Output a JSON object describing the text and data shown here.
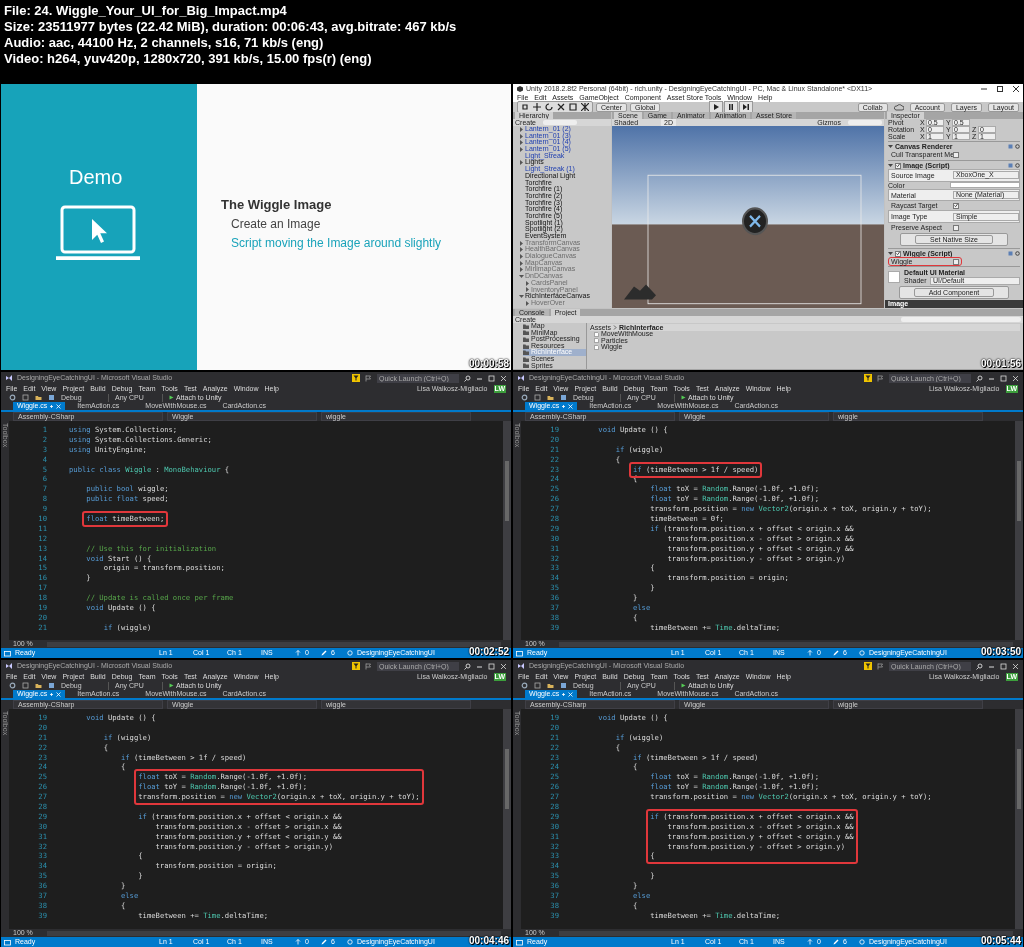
{
  "header": [
    "File: 24. Wiggle_Your_UI_for_Big_Impact.mp4",
    "Size: 23511977 bytes (22.42 MiB), duration: 00:06:43, avg.bitrate: 467 kb/s",
    "Audio: aac, 44100 Hz, 2 channels, s16, 71 kb/s (eng)",
    "Video: h264, yuv420p, 1280x720, 391 kb/s, 15.00 fps(r) (eng)"
  ],
  "frames": [
    {
      "kind": "slide",
      "side_title": "Demo",
      "heading": "The Wiggle Image",
      "points": [
        {
          "text": "Create an Image",
          "accent": false
        },
        {
          "text": "Script moving the Image around slightly",
          "accent": true
        }
      ],
      "timestamp": "00:00:58"
    },
    {
      "kind": "unity",
      "title": "Unity 2018.2.8f2 Personal (64bit) - rich.unity - DesigningEyeCatchingUI - PC, Mac & Linux Standalone* <DX11>",
      "menu": [
        "File",
        "Edit",
        "Assets",
        "GameObject",
        "Component",
        "Asset Store Tools",
        "Window",
        "Help"
      ],
      "pivot_buttons": [
        "Center",
        "Global"
      ],
      "right_buttons": [
        "Collab",
        "Account",
        "Layers",
        "Layout"
      ],
      "hierarchy": {
        "tab": "Hierarchy",
        "create": "Create",
        "items": [
          {
            "label": "Lantern_01 (2)",
            "kind": "collapsed",
            "prefab": true,
            "inactive": false
          },
          {
            "label": "Lantern_01 (3)",
            "kind": "collapsed",
            "prefab": true,
            "inactive": false
          },
          {
            "label": "Lantern_01 (4)",
            "kind": "collapsed",
            "prefab": true,
            "inactive": false
          },
          {
            "label": "Lantern_01 (5)",
            "kind": "collapsed",
            "prefab": true,
            "inactive": false
          },
          {
            "label": "Light_Streak",
            "kind": "leaf",
            "prefab": true,
            "inactive": false
          },
          {
            "label": "Lights",
            "kind": "collapsed",
            "prefab": false,
            "inactive": false
          },
          {
            "label": "Light_Streak (1)",
            "kind": "leaf",
            "prefab": true,
            "inactive": false
          },
          {
            "label": "Directional Light",
            "kind": "leaf",
            "prefab": false,
            "inactive": false
          },
          {
            "label": "Torchfire",
            "kind": "leaf",
            "prefab": false,
            "inactive": false
          },
          {
            "label": "Torchfire (1)",
            "kind": "leaf",
            "prefab": false,
            "inactive": false
          },
          {
            "label": "Torchfire (2)",
            "kind": "leaf",
            "prefab": false,
            "inactive": false
          },
          {
            "label": "Torchfire (3)",
            "kind": "leaf",
            "prefab": false,
            "inactive": false
          },
          {
            "label": "Torchfire (4)",
            "kind": "leaf",
            "prefab": false,
            "inactive": false
          },
          {
            "label": "Torchfire (5)",
            "kind": "leaf",
            "prefab": false,
            "inactive": false
          },
          {
            "label": "Spotlight (1)",
            "kind": "leaf",
            "prefab": false,
            "inactive": false
          },
          {
            "label": "Spotlight (2)",
            "kind": "leaf",
            "prefab": false,
            "inactive": false
          },
          {
            "label": "EventSystem",
            "kind": "leaf",
            "prefab": false,
            "inactive": false
          },
          {
            "label": "TransformCanvas",
            "kind": "collapsed",
            "prefab": false,
            "inactive": true
          },
          {
            "label": "HealthBarCanvas",
            "kind": "collapsed",
            "prefab": false,
            "inactive": true
          },
          {
            "label": "DialogueCanvas",
            "kind": "collapsed",
            "prefab": false,
            "inactive": true
          },
          {
            "label": "MapCanvas",
            "kind": "collapsed",
            "prefab": false,
            "inactive": true
          },
          {
            "label": "MinimapCanvas",
            "kind": "collapsed",
            "prefab": false,
            "inactive": true
          },
          {
            "label": "DnDCanvas",
            "kind": "expanded",
            "prefab": false,
            "inactive": true,
            "children": [
              {
                "label": "CardsPanel",
                "kind": "collapsed",
                "prefab": false,
                "inactive": true
              },
              {
                "label": "InventoryPanel",
                "kind": "collapsed",
                "prefab": false,
                "inactive": true
              }
            ]
          },
          {
            "label": "RichInterfaceCanvas",
            "kind": "expanded",
            "prefab": false,
            "inactive": false,
            "children": [
              {
                "label": "HoverOver",
                "kind": "collapsed",
                "prefab": false,
                "inactive": true
              }
            ]
          }
        ]
      },
      "scene": {
        "tabs": [
          {
            "label": "Scene",
            "selected": true
          },
          {
            "label": "Game",
            "selected": false
          },
          {
            "label": "Animator",
            "selected": false
          },
          {
            "label": "Animation",
            "selected": false
          },
          {
            "label": "Asset Store",
            "selected": false
          }
        ],
        "shading": "Shaded",
        "mode": "2D",
        "gizmos": "Gizmos"
      },
      "inspector": {
        "tab": "Inspector",
        "rows": [
          {
            "kind": "vector",
            "label": "Pivot",
            "values": [
              {
                "axis": "X",
                "value": "0.5"
              },
              {
                "axis": "Y",
                "value": "0.5"
              }
            ]
          },
          {
            "kind": "vector",
            "label": "Rotation",
            "values": [
              {
                "axis": "X",
                "value": "0"
              },
              {
                "axis": "Y",
                "value": "0"
              },
              {
                "axis": "Z",
                "value": "0"
              }
            ]
          },
          {
            "kind": "vector",
            "label": "Scale",
            "values": [
              {
                "axis": "X",
                "value": "1"
              },
              {
                "axis": "Y",
                "value": "1"
              },
              {
                "axis": "Z",
                "value": "1"
              }
            ]
          },
          {
            "kind": "component",
            "title": "Canvas Renderer"
          },
          {
            "kind": "checkbox",
            "label": "Cull Transparent Me",
            "checked": false,
            "highlighted": false
          },
          {
            "kind": "script",
            "title": "Image (Script)",
            "enabled": true
          },
          {
            "kind": "field",
            "label": "Source Image",
            "value": "XboxOne_X"
          },
          {
            "kind": "color",
            "label": "Color"
          },
          {
            "kind": "field",
            "label": "Material",
            "value": "None (Material)"
          },
          {
            "kind": "checkbox",
            "label": "Raycast Target",
            "checked": true,
            "highlighted": false
          },
          {
            "kind": "field",
            "label": "Image Type",
            "value": "Simple"
          },
          {
            "kind": "checkbox",
            "label": "Preserve Aspect",
            "checked": false,
            "highlighted": false
          },
          {
            "kind": "button",
            "label": "Set Native Size"
          },
          {
            "kind": "script",
            "title": "Wiggle (Script)",
            "enabled": true
          },
          {
            "kind": "checkbox",
            "label": "Wiggle",
            "checked": false,
            "highlighted": true
          },
          {
            "kind": "material",
            "title": "Default UI Material",
            "shader_label": "Shader",
            "shader": "UI/Default"
          },
          {
            "kind": "button",
            "label": "Add Component"
          }
        ],
        "preview": "Image"
      },
      "project": {
        "tabs": [
          {
            "label": "Console",
            "selected": false
          },
          {
            "label": "Project",
            "selected": true
          }
        ],
        "create": "Create",
        "folders": [
          {
            "label": "Map",
            "selected": false
          },
          {
            "label": "MiniMap",
            "selected": false
          },
          {
            "label": "PostProcessing",
            "selected": false
          },
          {
            "label": "Resources",
            "selected": false
          },
          {
            "label": "RichInterface",
            "selected": true
          },
          {
            "label": "Scenes",
            "selected": false
          },
          {
            "label": "Sprites",
            "selected": false
          }
        ],
        "path": [
          "Assets",
          "RichInterface"
        ],
        "files": [
          "MoveWithMouse",
          "Particles",
          "Wiggle"
        ]
      },
      "timestamp": "00:01:56"
    },
    {
      "kind": "editor",
      "title": "DesigningEyeCatchingUI - Microsoft Visual Studio",
      "search": {
        "placeholder": "Quick Launch (Ctrl+Q)"
      },
      "menu": [
        "File",
        "Edit",
        "View",
        "Project",
        "Build",
        "Debug",
        "Team",
        "Tools",
        "Test",
        "Analyze",
        "Window",
        "Help"
      ],
      "user": "Lisa Walkosz-Migliacio",
      "user_initials": "LW",
      "toolbar": [
        "Debug",
        "Any CPU"
      ],
      "run_button": "Attach to Unity",
      "tabs": [
        {
          "label": "Wiggle.cs",
          "selected": true
        },
        {
          "label": "ItemAction.cs",
          "selected": false
        },
        {
          "label": "MoveWithMouse.cs",
          "selected": false
        },
        {
          "label": "CardAction.cs",
          "selected": false
        }
      ],
      "side_panel": "Toolbox",
      "nav": [
        "Assembly-CSharp",
        "Wiggle",
        "wiggle"
      ],
      "zoom": "100 %",
      "status": {
        "text": "Ready",
        "line": "Ln 1",
        "column": "Col 1",
        "char": "Ch 1",
        "mode": "INS",
        "up_count": "0",
        "edit_count": "6",
        "project": "DesigningEyeCatchingUI"
      },
      "timestamp": "00:02:52",
      "code": [
        {
          "number": "1",
          "highlighted": false,
          "tokens": [
            {
              "kind": "kw",
              "text": "using"
            },
            {
              "kind": "plain",
              "text": " System.Collections;"
            }
          ]
        },
        {
          "number": "2",
          "highlighted": false,
          "tokens": [
            {
              "kind": "kw",
              "text": "using"
            },
            {
              "kind": "plain",
              "text": " System.Collections.Generic;"
            }
          ]
        },
        {
          "number": "3",
          "highlighted": false,
          "tokens": [
            {
              "kind": "kw",
              "text": "using"
            },
            {
              "kind": "plain",
              "text": " UnityEngine;"
            }
          ]
        },
        {
          "number": "4",
          "highlighted": false
        },
        {
          "number": "5",
          "highlighted": false,
          "tokens": [
            {
              "kind": "kw",
              "text": "public class "
            },
            {
              "kind": "type",
              "text": "Wiggle"
            },
            {
              "kind": "plain",
              "text": " : "
            },
            {
              "kind": "type",
              "text": "MonoBehaviour"
            },
            {
              "kind": "plain",
              "text": " {"
            }
          ]
        },
        {
          "number": "6",
          "highlighted": false
        },
        {
          "number": "7",
          "highlighted": false,
          "tokens": [
            {
              "kind": "kw",
              "text": "    public bool"
            },
            {
              "kind": "plain",
              "text": " wiggle;"
            }
          ]
        },
        {
          "number": "8",
          "highlighted": false,
          "tokens": [
            {
              "kind": "kw",
              "text": "    public float"
            },
            {
              "kind": "plain",
              "text": " speed;"
            }
          ]
        },
        {
          "number": "9",
          "highlighted": false
        },
        {
          "number": "10",
          "highlighted": true,
          "tokens": [
            {
              "kind": "kw",
              "text": "    float"
            },
            {
              "kind": "plain",
              "text": " timeBetween;"
            }
          ]
        },
        {
          "number": "11",
          "highlighted": false
        },
        {
          "number": "12",
          "highlighted": false
        },
        {
          "number": "13",
          "highlighted": false,
          "tokens": [
            {
              "kind": "comment",
              "text": "    // Use this for initialization"
            }
          ]
        },
        {
          "number": "14",
          "highlighted": false,
          "tokens": [
            {
              "kind": "kw",
              "text": "    void"
            },
            {
              "kind": "plain",
              "text": " Start () {"
            }
          ]
        },
        {
          "number": "15",
          "highlighted": false,
          "tokens": [
            {
              "kind": "plain",
              "text": "        origin = transform.position;"
            }
          ]
        },
        {
          "number": "16",
          "highlighted": false,
          "tokens": [
            {
              "kind": "plain",
              "text": "    }"
            }
          ]
        },
        {
          "number": "17",
          "highlighted": false
        },
        {
          "number": "18",
          "highlighted": false,
          "tokens": [
            {
              "kind": "comment",
              "text": "    // Update is called once per frame"
            }
          ]
        },
        {
          "number": "19",
          "highlighted": false,
          "tokens": [
            {
              "kind": "kw",
              "text": "    void"
            },
            {
              "kind": "plain",
              "text": " Update () {"
            }
          ]
        },
        {
          "number": "20",
          "highlighted": false
        },
        {
          "number": "21",
          "highlighted": false,
          "tokens": [
            {
              "kind": "kw",
              "text": "        if"
            },
            {
              "kind": "plain",
              "text": " (wiggle)"
            }
          ]
        }
      ]
    },
    {
      "kind": "editor",
      "title": "DesigningEyeCatchingUI - Microsoft Visual Studio",
      "search": {
        "placeholder": "Quick Launch (Ctrl+Q)"
      },
      "menu": [
        "File",
        "Edit",
        "View",
        "Project",
        "Build",
        "Debug",
        "Team",
        "Tools",
        "Test",
        "Analyze",
        "Window",
        "Help"
      ],
      "user": "Lisa Walkosz-Migliacio",
      "user_initials": "LW",
      "toolbar": [
        "Debug",
        "Any CPU"
      ],
      "run_button": "Attach to Unity",
      "tabs": [
        {
          "label": "Wiggle.cs",
          "selected": true
        },
        {
          "label": "ItemAction.cs",
          "selected": false
        },
        {
          "label": "MoveWithMouse.cs",
          "selected": false
        },
        {
          "label": "CardAction.cs",
          "selected": false
        }
      ],
      "side_panel": "Toolbox",
      "nav": [
        "Assembly-CSharp",
        "Wiggle",
        "wiggle"
      ],
      "zoom": "100 %",
      "status": {
        "text": "Ready",
        "line": "Ln 1",
        "column": "Col 1",
        "char": "Ch 1",
        "mode": "INS",
        "up_count": "0",
        "edit_count": "6",
        "project": "DesigningEyeCatchingUI"
      },
      "timestamp": "00:03:50",
      "code": [
        {
          "number": "19",
          "highlighted": false,
          "tokens": [
            {
              "kind": "kw",
              "text": "    void"
            },
            {
              "kind": "plain",
              "text": " Update () {"
            }
          ]
        },
        {
          "number": "20",
          "highlighted": false
        },
        {
          "number": "21",
          "highlighted": false,
          "tokens": [
            {
              "kind": "kw",
              "text": "        if"
            },
            {
              "kind": "plain",
              "text": " (wiggle)"
            }
          ]
        },
        {
          "number": "22",
          "highlighted": false,
          "tokens": [
            {
              "kind": "plain",
              "text": "        {"
            }
          ]
        },
        {
          "number": "23",
          "highlighted": true,
          "tokens": [
            {
              "kind": "kw",
              "text": "            if"
            },
            {
              "kind": "plain",
              "text": " (timeBetween > 1f / speed)"
            }
          ]
        },
        {
          "number": "24",
          "highlighted": false,
          "tokens": [
            {
              "kind": "plain",
              "text": "            {"
            }
          ]
        },
        {
          "number": "25",
          "highlighted": false,
          "tokens": [
            {
              "kind": "kw",
              "text": "                float"
            },
            {
              "kind": "plain",
              "text": " toX = "
            },
            {
              "kind": "type",
              "text": "Random"
            },
            {
              "kind": "plain",
              "text": ".Range(-1.0f, +1.0f);"
            }
          ]
        },
        {
          "number": "26",
          "highlighted": false,
          "tokens": [
            {
              "kind": "kw",
              "text": "                float"
            },
            {
              "kind": "plain",
              "text": " toY = "
            },
            {
              "kind": "type",
              "text": "Random"
            },
            {
              "kind": "plain",
              "text": ".Range(-1.0f, +1.0f);"
            }
          ]
        },
        {
          "number": "27",
          "highlighted": false,
          "tokens": [
            {
              "kind": "plain",
              "text": "                transform.position = "
            },
            {
              "kind": "kw",
              "text": "new "
            },
            {
              "kind": "type",
              "text": "Vector2"
            },
            {
              "kind": "plain",
              "text": "(origin.x + toX, origin.y + toY);"
            }
          ]
        },
        {
          "number": "28",
          "highlighted": false,
          "tokens": [
            {
              "kind": "plain",
              "text": "                timeBetween = 0f;"
            }
          ]
        },
        {
          "number": "29",
          "highlighted": false,
          "tokens": [
            {
              "kind": "kw",
              "text": "                if"
            },
            {
              "kind": "plain",
              "text": " (transform.position.x + offset < origin.x &&"
            }
          ]
        },
        {
          "number": "30",
          "highlighted": false,
          "tokens": [
            {
              "kind": "plain",
              "text": "                    transform.position.x - offset > origin.x &&"
            }
          ]
        },
        {
          "number": "31",
          "highlighted": false,
          "tokens": [
            {
              "kind": "plain",
              "text": "                    transform.position.y + offset < origin.y &&"
            }
          ]
        },
        {
          "number": "32",
          "highlighted": false,
          "tokens": [
            {
              "kind": "plain",
              "text": "                    transform.position.y - offset > origin.y)"
            }
          ]
        },
        {
          "number": "33",
          "highlighted": false,
          "tokens": [
            {
              "kind": "plain",
              "text": "                {"
            }
          ]
        },
        {
          "number": "34",
          "highlighted": false,
          "tokens": [
            {
              "kind": "plain",
              "text": "                    transform.position = origin;"
            }
          ]
        },
        {
          "number": "35",
          "highlighted": false,
          "tokens": [
            {
              "kind": "plain",
              "text": "                }"
            }
          ]
        },
        {
          "number": "36",
          "highlighted": false,
          "tokens": [
            {
              "kind": "plain",
              "text": "            }"
            }
          ]
        },
        {
          "number": "37",
          "highlighted": false,
          "tokens": [
            {
              "kind": "kw",
              "text": "            else"
            }
          ]
        },
        {
          "number": "38",
          "highlighted": false,
          "tokens": [
            {
              "kind": "plain",
              "text": "            {"
            }
          ]
        },
        {
          "number": "39",
          "highlighted": false,
          "tokens": [
            {
              "kind": "plain",
              "text": "                timeBetween += "
            },
            {
              "kind": "type",
              "text": "Time"
            },
            {
              "kind": "plain",
              "text": ".deltaTime;"
            }
          ]
        }
      ]
    },
    {
      "kind": "editor",
      "title": "DesigningEyeCatchingUI - Microsoft Visual Studio",
      "search": {
        "placeholder": "Quick Launch (Ctrl+Q)"
      },
      "menu": [
        "File",
        "Edit",
        "View",
        "Project",
        "Build",
        "Debug",
        "Team",
        "Tools",
        "Test",
        "Analyze",
        "Window",
        "Help"
      ],
      "user": "Lisa Walkosz-Migliacio",
      "user_initials": "LW",
      "toolbar": [
        "Debug",
        "Any CPU"
      ],
      "run_button": "Attach to Unity",
      "tabs": [
        {
          "label": "Wiggle.cs",
          "selected": true
        },
        {
          "label": "ItemAction.cs",
          "selected": false
        },
        {
          "label": "MoveWithMouse.cs",
          "selected": false
        },
        {
          "label": "CardAction.cs",
          "selected": false
        }
      ],
      "side_panel": "Toolbox",
      "nav": [
        "Assembly-CSharp",
        "Wiggle",
        "wiggle"
      ],
      "zoom": "100 %",
      "status": {
        "text": "Ready",
        "line": "Ln 1",
        "column": "Col 1",
        "char": "Ch 1",
        "mode": "INS",
        "up_count": "0",
        "edit_count": "6",
        "project": "DesigningEyeCatchingUI"
      },
      "timestamp": "00:04:46",
      "code": [
        {
          "number": "19",
          "highlighted": false,
          "tokens": [
            {
              "kind": "kw",
              "text": "    void"
            },
            {
              "kind": "plain",
              "text": " Update () {"
            }
          ]
        },
        {
          "number": "20",
          "highlighted": false
        },
        {
          "number": "21",
          "highlighted": false,
          "tokens": [
            {
              "kind": "kw",
              "text": "        if"
            },
            {
              "kind": "plain",
              "text": " (wiggle)"
            }
          ]
        },
        {
          "number": "22",
          "highlighted": false,
          "tokens": [
            {
              "kind": "plain",
              "text": "        {"
            }
          ]
        },
        {
          "number": "23",
          "highlighted": false,
          "tokens": [
            {
              "kind": "kw",
              "text": "            if"
            },
            {
              "kind": "plain",
              "text": " (timeBetween > 1f / speed)"
            }
          ]
        },
        {
          "number": "24",
          "highlighted": false,
          "tokens": [
            {
              "kind": "plain",
              "text": "            {"
            }
          ]
        },
        {
          "number": "25",
          "highlighted": true,
          "tokens": [
            {
              "kind": "kw",
              "text": "                float"
            },
            {
              "kind": "plain",
              "text": " toX = "
            },
            {
              "kind": "type",
              "text": "Random"
            },
            {
              "kind": "plain",
              "text": ".Range(-1.0f, +1.0f);"
            }
          ]
        },
        {
          "number": "26",
          "highlighted": true,
          "tokens": [
            {
              "kind": "kw",
              "text": "                float"
            },
            {
              "kind": "plain",
              "text": " toY = "
            },
            {
              "kind": "type",
              "text": "Random"
            },
            {
              "kind": "plain",
              "text": ".Range(-1.0f, +1.0f);"
            }
          ]
        },
        {
          "number": "27",
          "highlighted": true,
          "tokens": [
            {
              "kind": "plain",
              "text": "                transform.position = "
            },
            {
              "kind": "kw",
              "text": "new "
            },
            {
              "kind": "type",
              "text": "Vector2"
            },
            {
              "kind": "plain",
              "text": "(origin.x + toX, origin.y + toY);"
            }
          ]
        },
        {
          "number": "28",
          "highlighted": false
        },
        {
          "number": "29",
          "highlighted": false,
          "tokens": [
            {
              "kind": "kw",
              "text": "                if"
            },
            {
              "kind": "plain",
              "text": " (transform.position.x + offset < origin.x &&"
            }
          ]
        },
        {
          "number": "30",
          "highlighted": false,
          "tokens": [
            {
              "kind": "plain",
              "text": "                    transform.position.x - offset > origin.x &&"
            }
          ]
        },
        {
          "number": "31",
          "highlighted": false,
          "tokens": [
            {
              "kind": "plain",
              "text": "                    transform.position.y + offset < origin.y &&"
            }
          ]
        },
        {
          "number": "32",
          "highlighted": false,
          "tokens": [
            {
              "kind": "plain",
              "text": "                    transform.position.y - offset > origin.y)"
            }
          ]
        },
        {
          "number": "33",
          "highlighted": false,
          "tokens": [
            {
              "kind": "plain",
              "text": "                {"
            }
          ]
        },
        {
          "number": "34",
          "highlighted": false,
          "tokens": [
            {
              "kind": "plain",
              "text": "                    transform.position = origin;"
            }
          ]
        },
        {
          "number": "35",
          "highlighted": false,
          "tokens": [
            {
              "kind": "plain",
              "text": "                }"
            }
          ]
        },
        {
          "number": "36",
          "highlighted": false,
          "tokens": [
            {
              "kind": "plain",
              "text": "            }"
            }
          ]
        },
        {
          "number": "37",
          "highlighted": false,
          "tokens": [
            {
              "kind": "kw",
              "text": "            else"
            }
          ]
        },
        {
          "number": "38",
          "highlighted": false,
          "tokens": [
            {
              "kind": "plain",
              "text": "            {"
            }
          ]
        },
        {
          "number": "39",
          "highlighted": false,
          "tokens": [
            {
              "kind": "plain",
              "text": "                timeBetween += "
            },
            {
              "kind": "type",
              "text": "Time"
            },
            {
              "kind": "plain",
              "text": ".deltaTime;"
            }
          ]
        }
      ]
    },
    {
      "kind": "editor",
      "title": "DesigningEyeCatchingUI - Microsoft Visual Studio",
      "search": {
        "placeholder": "Quick Launch (Ctrl+Q)"
      },
      "menu": [
        "File",
        "Edit",
        "View",
        "Project",
        "Build",
        "Debug",
        "Team",
        "Tools",
        "Test",
        "Analyze",
        "Window",
        "Help"
      ],
      "user": "Lisa Walkosz-Migliacio",
      "user_initials": "LW",
      "toolbar": [
        "Debug",
        "Any CPU"
      ],
      "run_button": "Attach to Unity",
      "tabs": [
        {
          "label": "Wiggle.cs",
          "selected": true
        },
        {
          "label": "ItemAction.cs",
          "selected": false
        },
        {
          "label": "MoveWithMouse.cs",
          "selected": false
        },
        {
          "label": "CardAction.cs",
          "selected": false
        }
      ],
      "side_panel": "Toolbox",
      "nav": [
        "Assembly-CSharp",
        "Wiggle",
        "wiggle"
      ],
      "zoom": "100 %",
      "status": {
        "text": "Ready",
        "line": "Ln 1",
        "column": "Col 1",
        "char": "Ch 1",
        "mode": "INS",
        "up_count": "0",
        "edit_count": "6",
        "project": "DesigningEyeCatchingUI"
      },
      "timestamp": "00:05:44",
      "code": [
        {
          "number": "19",
          "highlighted": false,
          "tokens": [
            {
              "kind": "kw",
              "text": "    void"
            },
            {
              "kind": "plain",
              "text": " Update () {"
            }
          ]
        },
        {
          "number": "20",
          "highlighted": false
        },
        {
          "number": "21",
          "highlighted": false,
          "tokens": [
            {
              "kind": "kw",
              "text": "        if"
            },
            {
              "kind": "plain",
              "text": " (wiggle)"
            }
          ]
        },
        {
          "number": "22",
          "highlighted": false,
          "tokens": [
            {
              "kind": "plain",
              "text": "        {"
            }
          ]
        },
        {
          "number": "23",
          "highlighted": false,
          "tokens": [
            {
              "kind": "kw",
              "text": "            if"
            },
            {
              "kind": "plain",
              "text": " (timeBetween > 1f / speed)"
            }
          ]
        },
        {
          "number": "24",
          "highlighted": false,
          "tokens": [
            {
              "kind": "plain",
              "text": "            {"
            }
          ]
        },
        {
          "number": "25",
          "highlighted": false,
          "tokens": [
            {
              "kind": "kw",
              "text": "                float"
            },
            {
              "kind": "plain",
              "text": " toX = "
            },
            {
              "kind": "type",
              "text": "Random"
            },
            {
              "kind": "plain",
              "text": ".Range(-1.0f, +1.0f);"
            }
          ]
        },
        {
          "number": "26",
          "highlighted": false,
          "tokens": [
            {
              "kind": "kw",
              "text": "                float"
            },
            {
              "kind": "plain",
              "text": " toY = "
            },
            {
              "kind": "type",
              "text": "Random"
            },
            {
              "kind": "plain",
              "text": ".Range(-1.0f, +1.0f);"
            }
          ]
        },
        {
          "number": "27",
          "highlighted": false,
          "tokens": [
            {
              "kind": "plain",
              "text": "                transform.position = "
            },
            {
              "kind": "kw",
              "text": "new "
            },
            {
              "kind": "type",
              "text": "Vector2"
            },
            {
              "kind": "plain",
              "text": "(origin.x + toX, origin.y + toY);"
            }
          ]
        },
        {
          "number": "28",
          "highlighted": false
        },
        {
          "number": "29",
          "highlighted": true,
          "tokens": [
            {
              "kind": "kw",
              "text": "                if"
            },
            {
              "kind": "plain",
              "text": " (transform.position.x + offset < origin.x &&"
            }
          ]
        },
        {
          "number": "30",
          "highlighted": true,
          "tokens": [
            {
              "kind": "plain",
              "text": "                    transform.position.x - offset > origin.x &&"
            }
          ]
        },
        {
          "number": "31",
          "highlighted": true,
          "tokens": [
            {
              "kind": "plain",
              "text": "                    transform.position.y + offset < origin.y &&"
            }
          ]
        },
        {
          "number": "32",
          "highlighted": true,
          "tokens": [
            {
              "kind": "plain",
              "text": "                    transform.position.y - offset > origin.y)"
            }
          ]
        },
        {
          "number": "33",
          "highlighted": true,
          "tokens": [
            {
              "kind": "plain",
              "text": "                {"
            }
          ]
        },
        {
          "number": "34",
          "highlighted": false
        },
        {
          "number": "35",
          "highlighted": false,
          "tokens": [
            {
              "kind": "plain",
              "text": "                }"
            }
          ]
        },
        {
          "number": "36",
          "highlighted": false,
          "tokens": [
            {
              "kind": "plain",
              "text": "            }"
            }
          ]
        },
        {
          "number": "37",
          "highlighted": false,
          "tokens": [
            {
              "kind": "kw",
              "text": "            else"
            }
          ]
        },
        {
          "number": "38",
          "highlighted": false,
          "tokens": [
            {
              "kind": "plain",
              "text": "            {"
            }
          ]
        },
        {
          "number": "39",
          "highlighted": false,
          "tokens": [
            {
              "kind": "plain",
              "text": "                timeBetween += "
            },
            {
              "kind": "type",
              "text": "Time"
            },
            {
              "kind": "plain",
              "text": ".deltaTime;"
            }
          ]
        }
      ]
    }
  ]
}
